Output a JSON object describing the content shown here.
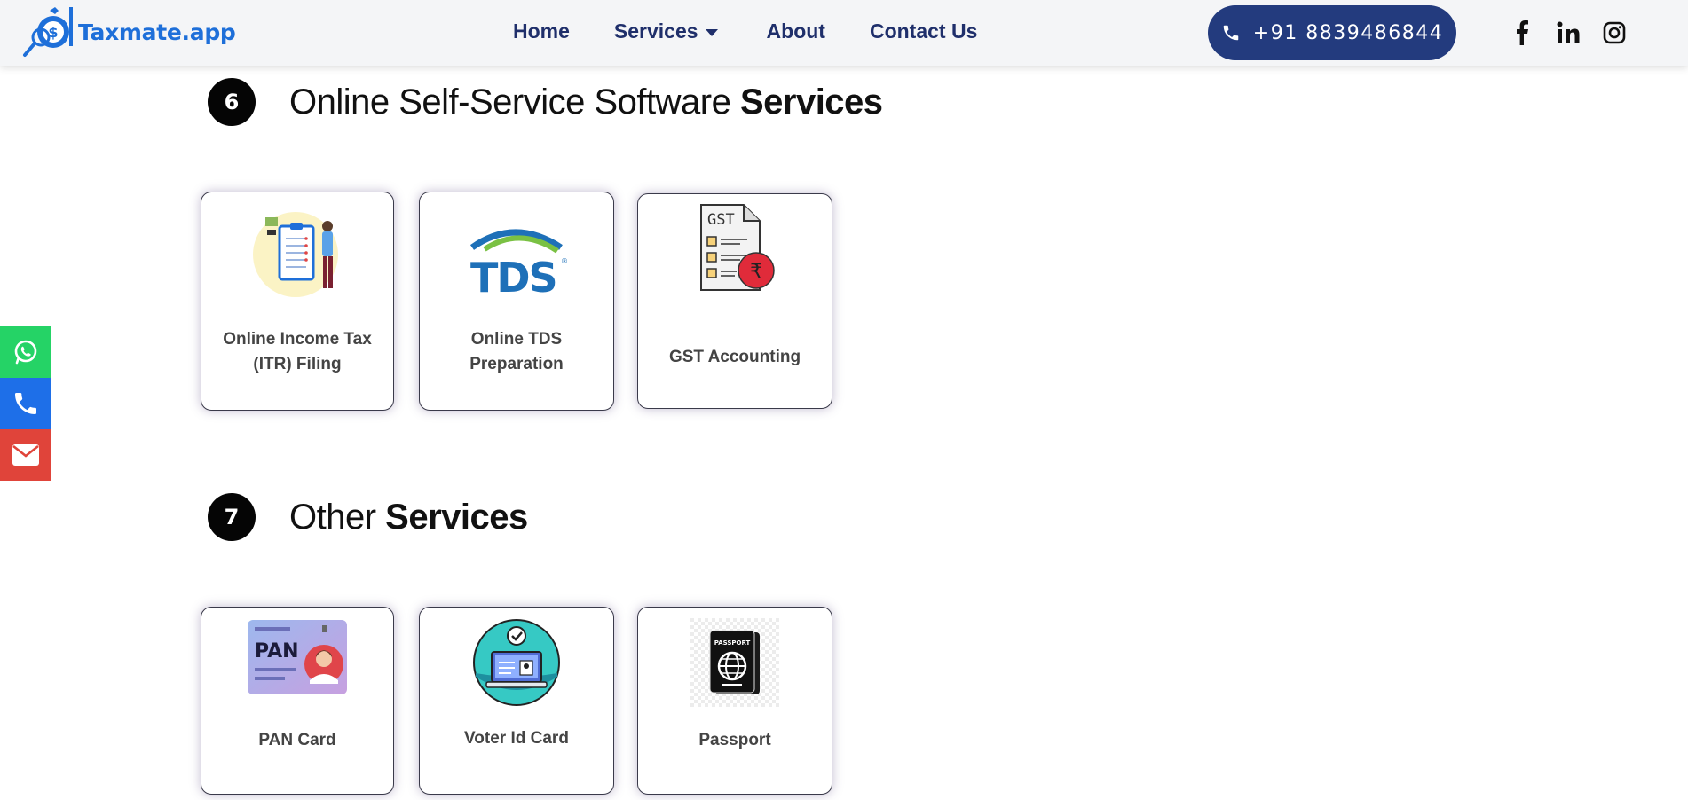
{
  "header": {
    "logo_text": "Taxmate.app",
    "nav": [
      {
        "label": "Home"
      },
      {
        "label": "Services"
      },
      {
        "label": "About"
      },
      {
        "label": "Contact Us"
      }
    ],
    "phone_label": "+91 8839486844",
    "socials": [
      "facebook-icon",
      "linkedin-icon",
      "instagram-icon"
    ]
  },
  "side_buttons": [
    "whatsapp-icon",
    "phone-icon",
    "mail-icon"
  ],
  "sections": [
    {
      "number": "6",
      "title_light": "Online Self-Service Software ",
      "title_bold": "Services",
      "cards": [
        {
          "label_line1": "Online Income Tax",
          "label_line2": "(ITR) Filing",
          "icon": "itr-illustration"
        },
        {
          "label_line1": "Online TDS",
          "label_line2": "Preparation",
          "icon": "tds-logo",
          "logo_text": "TDS"
        },
        {
          "label_line1": "GST Accounting",
          "icon": "gst-document-icon",
          "doc_text": "GST",
          "currency": "₹"
        }
      ]
    },
    {
      "number": "7",
      "title_light": "Other ",
      "title_bold": "Services",
      "cards": [
        {
          "label_line1": "PAN Card",
          "icon": "pan-card-icon",
          "card_text": "PAN"
        },
        {
          "label_line1": "Voter Id Card",
          "icon": "voter-id-icon"
        },
        {
          "label_line1": "Passport",
          "icon": "passport-icon",
          "passport_text": "PASSPORT"
        }
      ]
    }
  ],
  "colors": {
    "header_bg": "#f4f5f7",
    "nav_text": "#1f2f6b",
    "phone_btn": "#233b7e",
    "brand_blue": "#1e6fd9",
    "whatsapp": "#25d366",
    "call": "#1e6fe8",
    "mail": "#e0443a"
  }
}
